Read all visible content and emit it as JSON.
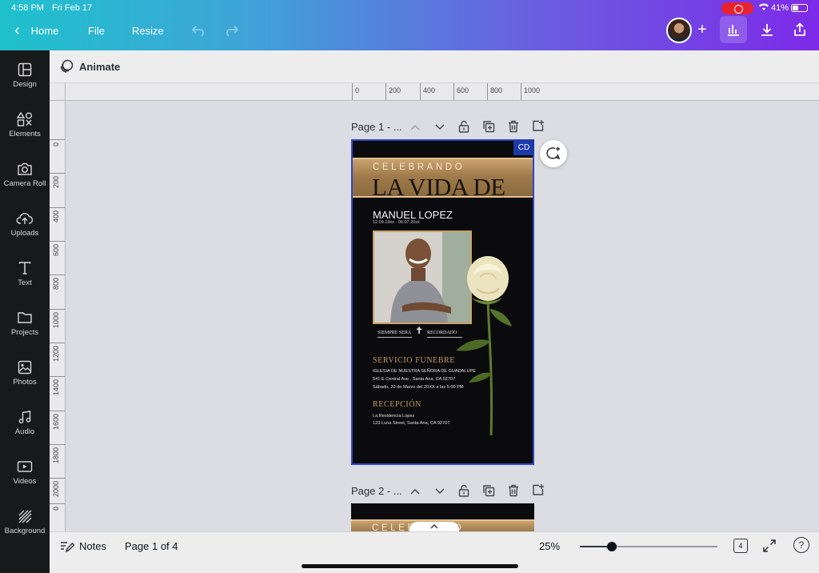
{
  "status": {
    "time": "4:58 PM",
    "date": "Fri Feb 17",
    "battery": "41%"
  },
  "toolbar": {
    "back_label": "Home",
    "file_label": "File",
    "resize_label": "Resize",
    "plus": "+"
  },
  "sidebar": {
    "items": [
      {
        "label": "Design",
        "icon": "design-icon"
      },
      {
        "label": "Elements",
        "icon": "elements-icon"
      },
      {
        "label": "Camera Roll",
        "icon": "camera-icon"
      },
      {
        "label": "Uploads",
        "icon": "upload-cloud-icon"
      },
      {
        "label": "Text",
        "icon": "text-icon"
      },
      {
        "label": "Projects",
        "icon": "folder-icon"
      },
      {
        "label": "Photos",
        "icon": "photo-icon"
      },
      {
        "label": "Audio",
        "icon": "music-note-icon"
      },
      {
        "label": "Videos",
        "icon": "video-icon"
      },
      {
        "label": "Background",
        "icon": "background-pattern-icon"
      }
    ]
  },
  "animate_label": "Animate",
  "ruler": {
    "horizontal": [
      "0",
      "200",
      "400",
      "600",
      "800",
      "1000"
    ],
    "vertical": [
      "0",
      "200",
      "400",
      "600",
      "800",
      "1000",
      "1200",
      "1400",
      "1600",
      "1800",
      "2000",
      "0"
    ]
  },
  "pages": [
    {
      "title": "Page 1 - ..."
    },
    {
      "title": "Page 2 - ..."
    }
  ],
  "design": {
    "badge": "CD",
    "celebrando": "CELEBRANDO",
    "heading": "LA VIDA DE",
    "name": "MANUEL LOPEZ",
    "dates": "12.09.19xx - 06.07.20xx",
    "siempre": "SIEMPRE SERÁ",
    "cross": "✝",
    "recordado": "RECORDADO",
    "service_title": "SERVICIO FUNEBRE",
    "service_lines": [
      "IGLESIA DE NUESTRA SEÑORA DE GUADALUPE",
      "541 E Central Ave., Santa Ana, CA 92707",
      "Sábado, 20 de Marzo del 20XX a las 5:00 PM"
    ],
    "reception_title": "RECEPCIÓN",
    "reception_lines": [
      "La Residencia Lopez",
      "123 Luna Street, Santa Ana, CA 92707"
    ],
    "page2_celebrando": "CELEBRANDO"
  },
  "bottom": {
    "notes_label": "Notes",
    "page_indicator": "Page 1 of 4",
    "zoom": "25%",
    "zoom_slider_fraction": 0.23,
    "page_count": "4",
    "help": "?"
  },
  "colors": {
    "accent_purple": "#7d2ae8",
    "selection_blue": "#2f47c9",
    "gold": "#c49b64"
  }
}
